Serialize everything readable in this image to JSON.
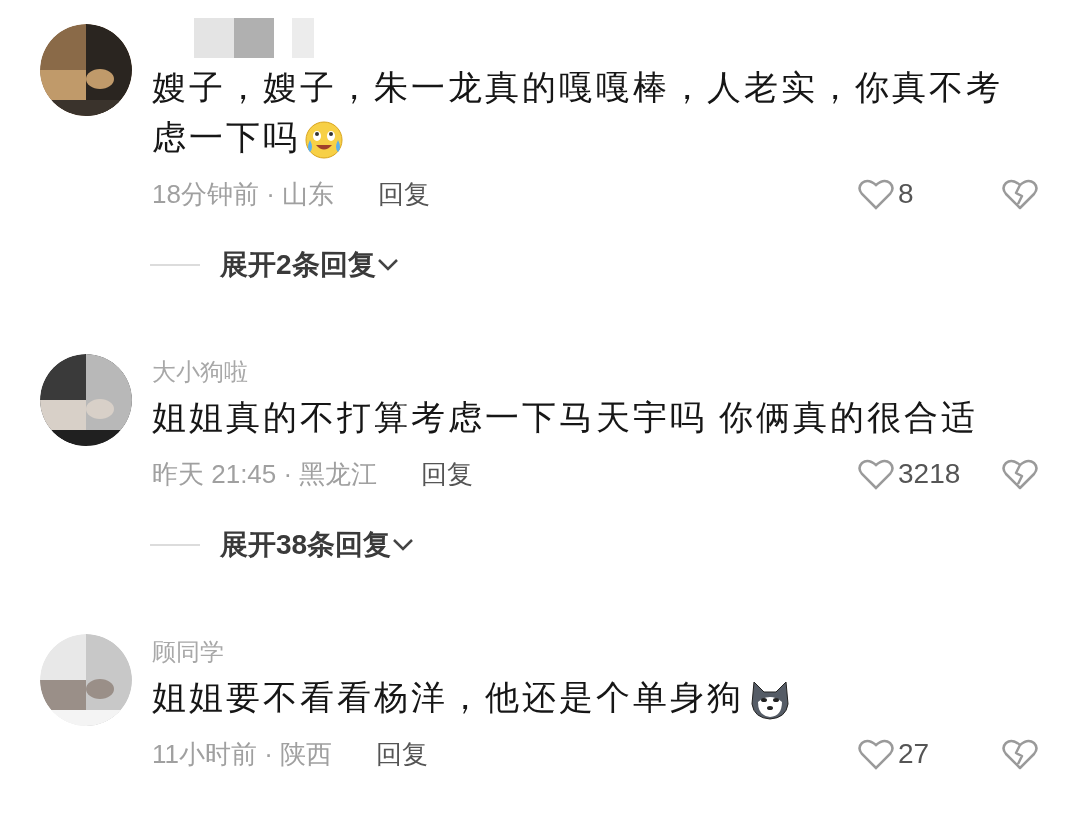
{
  "comments": [
    {
      "username_masked": true,
      "text": "嫂子，嫂子，朱一龙真的嘎嘎棒，人老实，你真不考虑一下吗",
      "emoji": {
        "kind": "face"
      },
      "time": "18分钟前 · 山东",
      "reply": "回复",
      "likes": "8",
      "expand": "展开2条回复"
    },
    {
      "username": "大小狗啦",
      "text": "姐姐真的不打算考虑一下马天宇吗 你俩真的很合适",
      "time": "昨天 21:45 · 黑龙江",
      "reply": "回复",
      "likes": "3218",
      "expand": "展开38条回复"
    },
    {
      "username": "顾同学",
      "text": "姐姐要不看看杨洋，他还是个单身狗",
      "emoji": {
        "kind": "dog"
      },
      "time": "11小时前 · 陕西",
      "reply": "回复",
      "likes": "27"
    }
  ]
}
